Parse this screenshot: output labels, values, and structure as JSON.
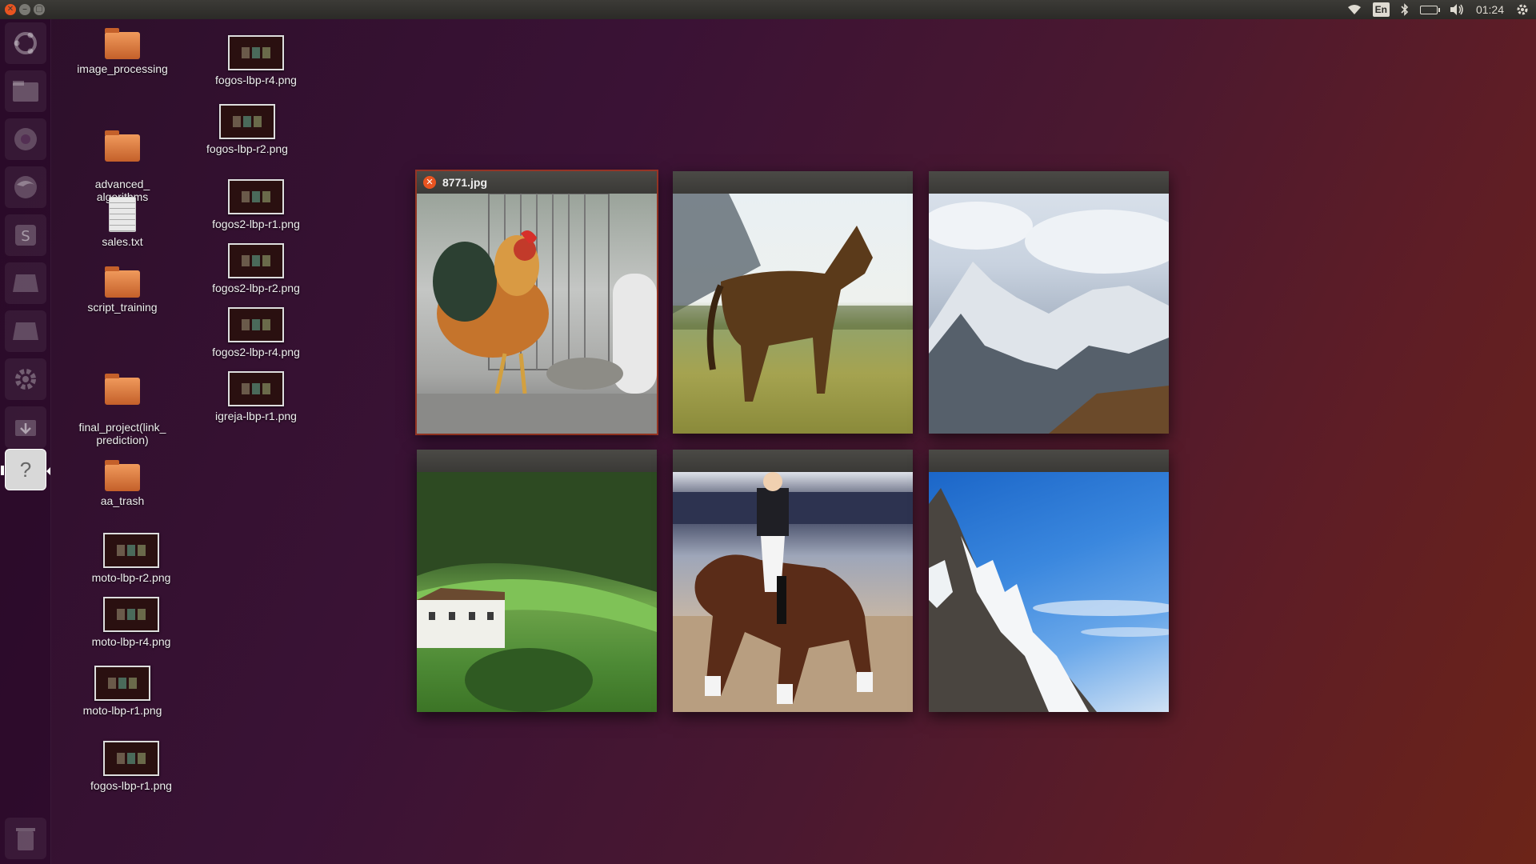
{
  "panel": {
    "window_controls": {
      "close": "✕",
      "minimize": "–",
      "maximize": "▢"
    },
    "indicators": {
      "wifi_icon": "wifi-icon",
      "keyboard_layout": "En",
      "bluetooth_icon": "bluetooth-icon",
      "battery_icon": "battery-icon",
      "volume_icon": "volume-icon",
      "clock": "01:24",
      "settings_icon": "gear-icon"
    }
  },
  "launcher": {
    "items": [
      {
        "name": "ubuntu-dash-icon"
      },
      {
        "name": "files-icon"
      },
      {
        "name": "chromium-icon"
      },
      {
        "name": "firefox-icon"
      },
      {
        "name": "sublime-text-icon"
      },
      {
        "name": "libreoffice-impress-icon"
      },
      {
        "name": "libreoffice-writer-icon"
      },
      {
        "name": "system-settings-icon"
      },
      {
        "name": "software-updater-icon"
      },
      {
        "name": "help-icon",
        "glyph": "?"
      },
      {
        "name": "trash-icon"
      }
    ]
  },
  "desktop": {
    "col1": [
      {
        "label": "image_processing",
        "kind": "folder"
      },
      {
        "label": "advanced_\nalgorithms",
        "kind": "folder"
      },
      {
        "label": "sales.txt",
        "kind": "text"
      },
      {
        "label": "script_training",
        "kind": "folder"
      },
      {
        "label": "final_project(link_\nprediction)",
        "kind": "folder"
      },
      {
        "label": "aa_trash",
        "kind": "folder"
      },
      {
        "label": "moto-lbp-r2.png",
        "kind": "image"
      },
      {
        "label": "moto-lbp-r4.png",
        "kind": "image"
      },
      {
        "label": "moto-lbp-r1.png",
        "kind": "image"
      },
      {
        "label": "fogos-lbp-r1.png",
        "kind": "image"
      }
    ],
    "col2": [
      {
        "label": "fogos-lbp-r4.png",
        "kind": "image"
      },
      {
        "label": "fogos-lbp-r2.png",
        "kind": "image"
      },
      {
        "label": "fogos2-lbp-r1.png",
        "kind": "image"
      },
      {
        "label": "fogos2-lbp-r2.png",
        "kind": "image"
      },
      {
        "label": "fogos2-lbp-r4.png",
        "kind": "image"
      },
      {
        "label": "igreja-lbp-r1.png",
        "kind": "image"
      }
    ]
  },
  "spread": {
    "windows": [
      {
        "title": "8771.jpg",
        "active": true,
        "image": "rooster"
      },
      {
        "title": "",
        "active": false,
        "image": "horse-in-field"
      },
      {
        "title": "",
        "active": false,
        "image": "snowy-mountains"
      },
      {
        "title": "",
        "active": false,
        "image": "green-valley-house"
      },
      {
        "title": "",
        "active": false,
        "image": "dressage-rider"
      },
      {
        "title": "",
        "active": false,
        "image": "rocky-peak-blue-sky"
      }
    ],
    "close_glyph": "✕"
  },
  "colors": {
    "accent": "#e95420",
    "panel": "#3c3b37",
    "window_frame": "#3a3936"
  }
}
